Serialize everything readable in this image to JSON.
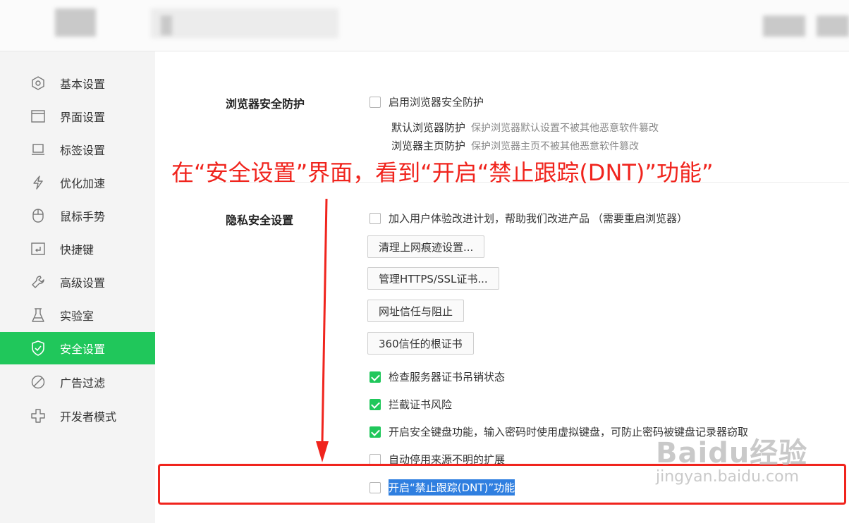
{
  "sidebar": {
    "items": [
      {
        "label": "基本设置",
        "icon": "hexagon-settings-icon"
      },
      {
        "label": "界面设置",
        "icon": "window-icon"
      },
      {
        "label": "标签设置",
        "icon": "tab-icon"
      },
      {
        "label": "优化加速",
        "icon": "lightning-icon"
      },
      {
        "label": "鼠标手势",
        "icon": "mouse-icon"
      },
      {
        "label": "快捷键",
        "icon": "keyboard-shortcut-icon"
      },
      {
        "label": "高级设置",
        "icon": "wrench-icon"
      },
      {
        "label": "实验室",
        "icon": "flask-icon"
      },
      {
        "label": "安全设置",
        "icon": "shield-check-icon",
        "active": true
      },
      {
        "label": "广告过滤",
        "icon": "block-icon"
      },
      {
        "label": "开发者模式",
        "icon": "developer-icon"
      }
    ]
  },
  "browser_protection": {
    "title": "浏览器安全防护",
    "enable_label": "启用浏览器安全防护",
    "enabled": false,
    "default_name": "默认浏览器防护",
    "default_desc": "保护浏览器默认设置不被其他恶意软件篡改",
    "home_name": "浏览器主页防护",
    "home_desc": "保护浏览器主页不被其他恶意软件篡改"
  },
  "privacy": {
    "title": "隐私安全设置",
    "ux_plan_label": "加入用户体验改进计划，帮助我们改进产品",
    "ux_plan_note": "（需要重启浏览器）",
    "ux_plan_checked": false,
    "buttons": [
      "清理上网痕迹设置...",
      "管理HTTPS/SSL证书...",
      "网址信任与阻止",
      "360信任的根证书"
    ],
    "checks": [
      {
        "label": "检查服务器证书吊销状态",
        "checked": true
      },
      {
        "label": "拦截证书风险",
        "checked": true
      },
      {
        "label": "开启安全键盘功能，输入密码时使用虚拟键盘，可防止密码被键盘记录器窃取",
        "checked": true
      },
      {
        "label": "自动停用来源不明的扩展",
        "checked": false
      },
      {
        "label": "开启“禁止跟踪(DNT)”功能",
        "checked": false
      }
    ]
  },
  "annotation": {
    "text": "在“安全设置”界面，看到“开启“禁止跟踪(DNT)”功能”",
    "color": "#f0241d"
  },
  "watermark": {
    "brand": "Baidu经验",
    "url": "jingyan.baidu.com"
  },
  "colors": {
    "accent": "#20c75b",
    "highlight": "#2f7fe0"
  }
}
